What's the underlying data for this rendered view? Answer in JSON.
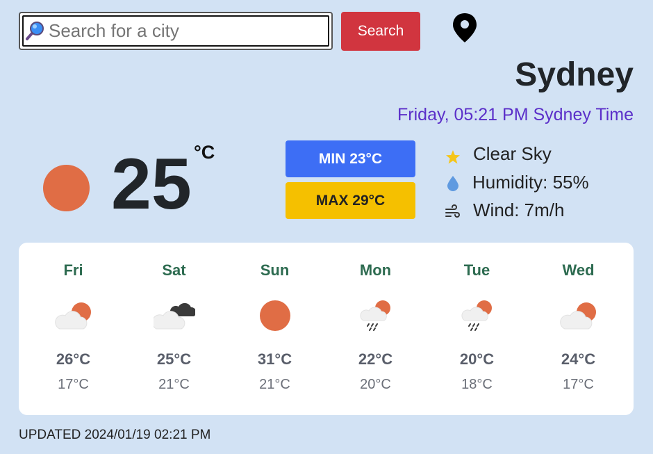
{
  "search": {
    "placeholder": "Search for a city",
    "button_label": "Search"
  },
  "location": {
    "city": "Sydney",
    "datetime": "Friday, 05:21 PM Sydney Time"
  },
  "current": {
    "temp": "25",
    "unit": "°C",
    "min": "MIN 23°C",
    "max": "MAX 29°C",
    "condition": "Clear Sky",
    "humidity": "Humidity: 55%",
    "wind": "Wind: 7m/h",
    "condition_icon": "sun-icon"
  },
  "forecast": [
    {
      "day": "Fri",
      "high": "26°C",
      "low": "17°C",
      "icon": "partly-cloudy-icon"
    },
    {
      "day": "Sat",
      "high": "25°C",
      "low": "21°C",
      "icon": "cloudy-icon"
    },
    {
      "day": "Sun",
      "high": "31°C",
      "low": "21°C",
      "icon": "sun-icon"
    },
    {
      "day": "Mon",
      "high": "22°C",
      "low": "20°C",
      "icon": "rain-icon"
    },
    {
      "day": "Tue",
      "high": "20°C",
      "low": "18°C",
      "icon": "rain-icon"
    },
    {
      "day": "Wed",
      "high": "24°C",
      "low": "17°C",
      "icon": "partly-cloudy-icon"
    }
  ],
  "updated": "UPDATED 2024/01/19 02:21 PM",
  "colors": {
    "background": "#d2e2f4",
    "search_button": "#d1353f",
    "min_badge": "#3d6ef5",
    "max_badge": "#f5c000",
    "sun": "#e06d45",
    "datetime": "#5b2fc9",
    "day_name": "#2d6b50"
  }
}
